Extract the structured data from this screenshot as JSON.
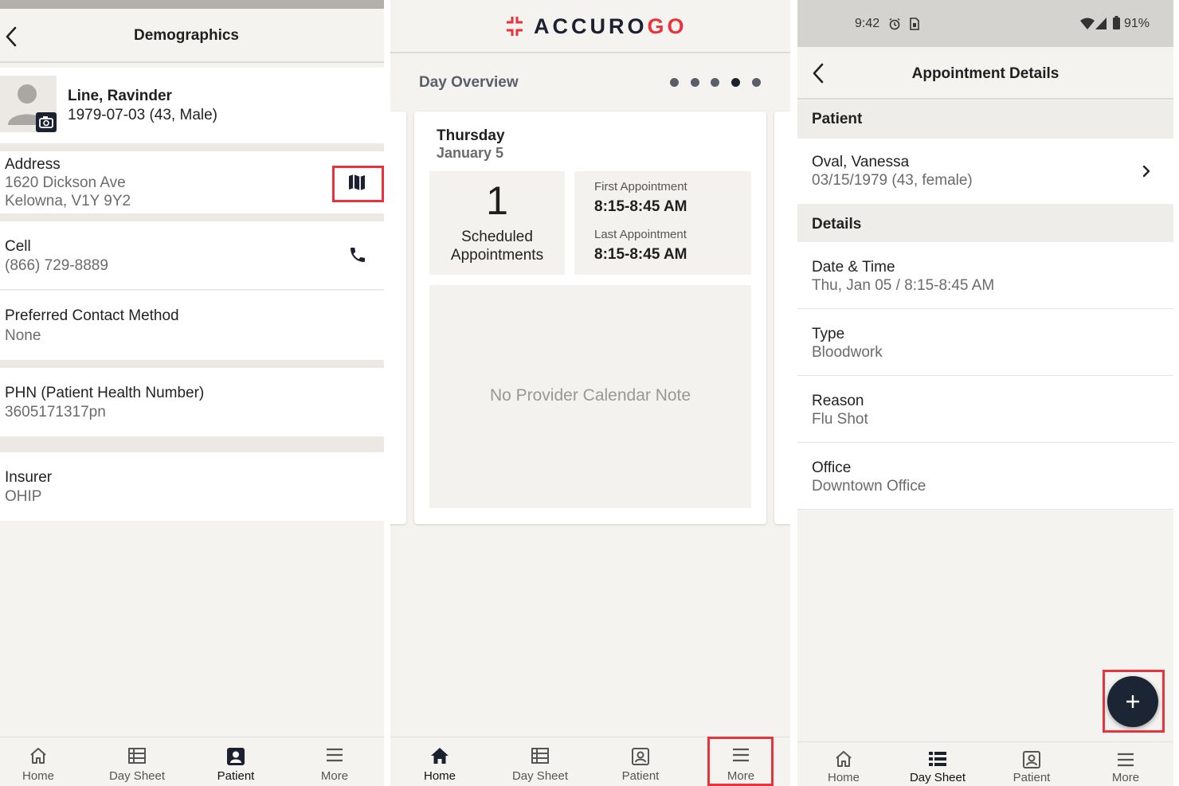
{
  "colors": {
    "accent": "#e8323c",
    "dark": "#1c2533",
    "background": "#f5f3f0"
  },
  "demographics": {
    "title": "Demographics",
    "patient_name": "Line, Ravinder",
    "patient_dob": "1979-07-03 (43, Male)",
    "address_label": "Address",
    "address_line1": "1620 Dickson Ave",
    "address_line2": "Kelowna, V1Y 9Y2",
    "cell_label": "Cell",
    "cell_value": "(866) 729-8889",
    "contact_label": "Preferred Contact Method",
    "contact_value": "None",
    "phn_label": "PHN (Patient Health Number)",
    "phn_value": "3605171317pn",
    "insurer_label": "Insurer",
    "insurer_value": "OHIP"
  },
  "home": {
    "logo_accuro": "ACCURO",
    "logo_go": "GO",
    "day_overview_label": "Day Overview",
    "day_name": "Thursday",
    "date": "January 5",
    "scheduled_count": "1",
    "scheduled_label_1": "Scheduled",
    "scheduled_label_2": "Appointments",
    "first_appt_label": "First Appointment",
    "first_appt_time": "8:15-8:45 AM",
    "last_appt_label": "Last Appointment",
    "last_appt_time": "8:15-8:45 AM",
    "calendar_note": "No Provider Calendar Note",
    "page_dots": {
      "count": 5,
      "active_index": 3
    }
  },
  "appointment": {
    "status_time": "9:42",
    "battery": "91%",
    "title": "Appointment Details",
    "patient_section": "Patient",
    "patient_name": "Oval, Vanessa",
    "patient_dob": "03/15/1979 (43, female)",
    "details_section": "Details",
    "datetime_label": "Date & Time",
    "datetime_value": "Thu, Jan 05 / 8:15-8:45 AM",
    "type_label": "Type",
    "type_value": "Bloodwork",
    "reason_label": "Reason",
    "reason_value": "Flu Shot",
    "office_label": "Office",
    "office_value": "Downtown Office"
  },
  "nav": {
    "home": "Home",
    "day_sheet": "Day Sheet",
    "patient": "Patient",
    "more": "More"
  }
}
